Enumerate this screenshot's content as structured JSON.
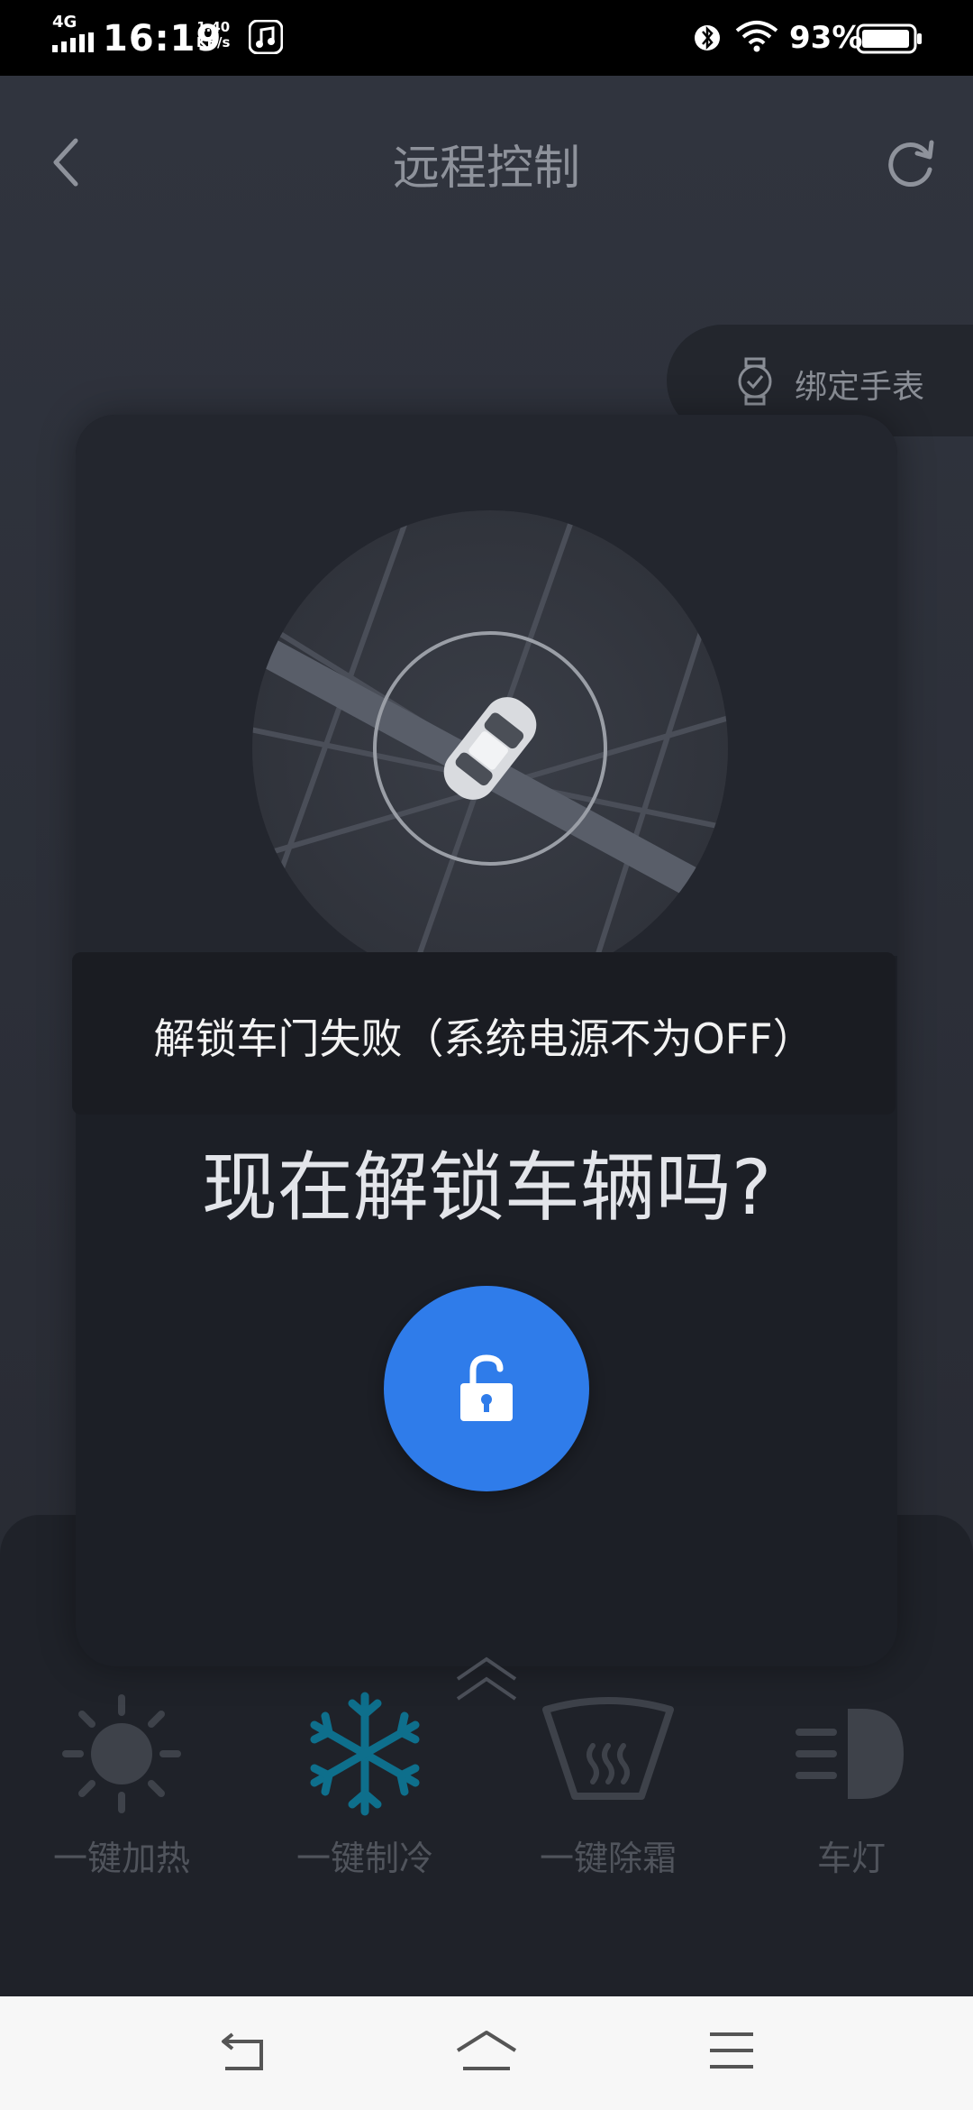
{
  "status_bar": {
    "network": "4G",
    "time": "16:19",
    "speed_value": "1.40",
    "speed_unit": "KB/s",
    "battery": "93%"
  },
  "header": {
    "title": "远程控制",
    "back_icon": "back-arrow-icon",
    "refresh_icon": "refresh-icon"
  },
  "bind_watch": {
    "label": "绑定手表",
    "icon": "watch-icon"
  },
  "dialog": {
    "fail_message": "解锁车门失败（系统电源不为OFF）",
    "question": "现在解锁车辆吗?",
    "unlock_icon": "unlock-icon",
    "accent_color": "#2f7cea"
  },
  "functions": [
    {
      "label": "一键加热",
      "icon": "sun-icon"
    },
    {
      "label": "一键制冷",
      "icon": "snowflake-icon",
      "active": true,
      "color": "#0e8fb3"
    },
    {
      "label": "一键除霜",
      "icon": "defrost-icon"
    },
    {
      "label": "车灯",
      "icon": "headlight-icon"
    }
  ],
  "navbar": {
    "back_icon": "nav-back-icon",
    "home_icon": "nav-home-icon",
    "menu_icon": "nav-menu-icon"
  }
}
